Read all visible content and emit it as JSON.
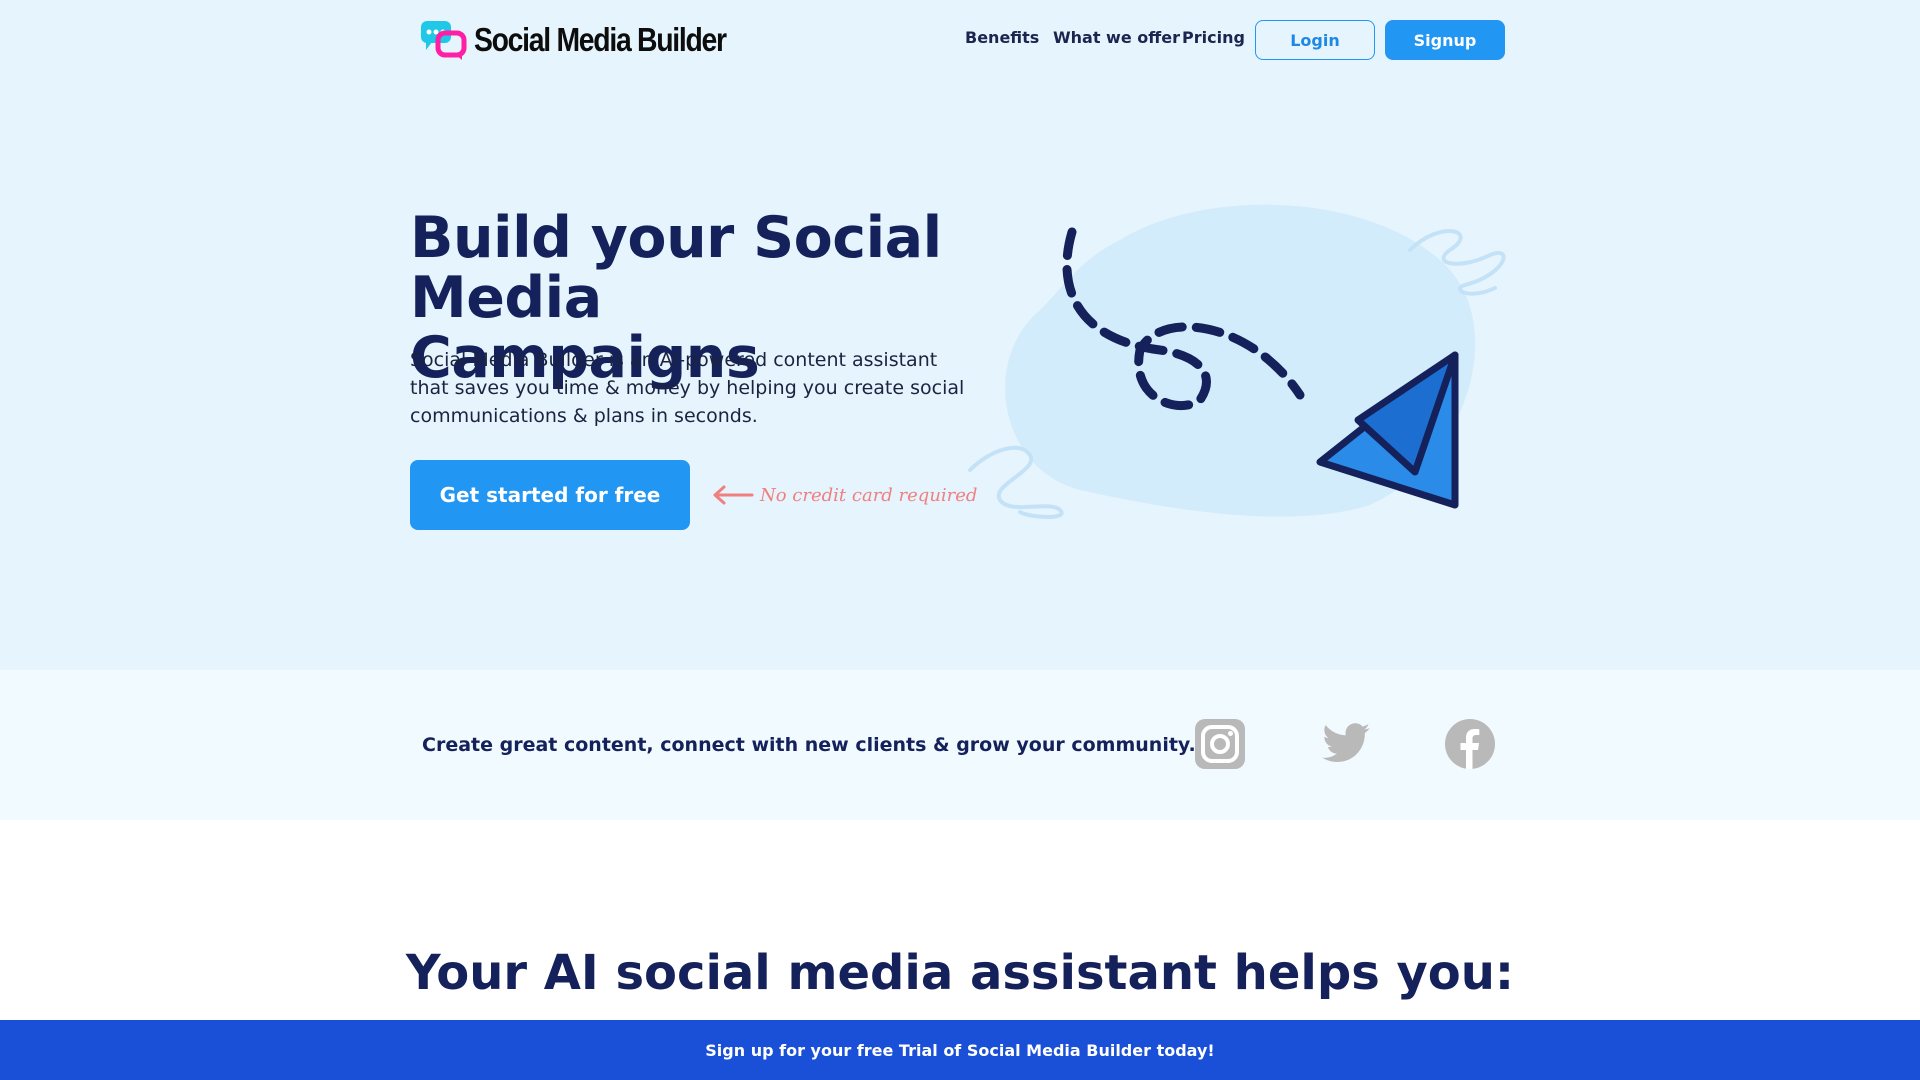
{
  "header": {
    "logo_text": "Social Media Builder",
    "nav": [
      "Benefits",
      "What we offer",
      "Pricing"
    ],
    "login_label": "Login",
    "signup_label": "Signup"
  },
  "hero": {
    "title_line1": "Build your Social",
    "title_line2": "Media Campaigns",
    "subtitle": "Social Media Builder is an AI-powered content assistant that saves you time & money by helping you create social communications & plans in seconds.",
    "cta_label": "Get started for free",
    "note": "No credit card required"
  },
  "strip": {
    "tagline": "Create great content, connect with new clients & grow your community.",
    "icons": [
      "instagram-icon",
      "twitter-icon",
      "facebook-icon"
    ]
  },
  "section": {
    "title": "Your AI social media assistant helps you:"
  },
  "banner": {
    "text": "Sign up for your free Trial of Social Media Builder today!"
  },
  "colors": {
    "primary": "#2196f3",
    "navy": "#14215a",
    "hero_bg": "#e6f4fd",
    "banner_bg": "#1a4fd8",
    "note_pink": "#f08080",
    "logo_cyan": "#1ec8e6",
    "logo_magenta": "#ff1fa6"
  }
}
